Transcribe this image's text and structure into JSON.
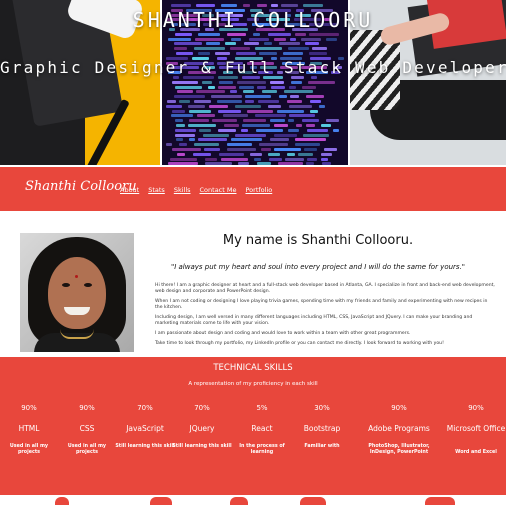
{
  "hero": {
    "title": "SHANTHI COLLOORU",
    "subtitle": "Graphic Designer & Full Stack Web Developer"
  },
  "nav": {
    "brand": "Shanthi Collooru",
    "links": [
      "About",
      "Stats",
      "Skills",
      "Contact Me",
      "Portfolio"
    ]
  },
  "about": {
    "heading": "My name is Shanthi Collooru.",
    "quote": "\"I always put my heart and soul into every project and I will do the same for yours.\"",
    "paragraphs": [
      "Hi there! I am a graphic designer at heart and a full-stack web developer based in Atlanta, GA. I specialize in front and back-end web development, web design and corporate and PowerPoint design.",
      "When I am not coding or designing I love playing trivia games, spending time with my friends and family and experimenting with new recipes in the kitchen.",
      "Including design, I am well versed in many different languages including HTML, CSS, JavaScript and JQuery. I can make your branding and marketing materials come to life with your vision.",
      "I am passionate about design and coding and would love to work within a team with other great programmers.",
      "Take time to look through my portfolio, my LinkedIn profile or you can contact me directly. I look forward to working with you!"
    ]
  },
  "skills": {
    "title": "TECHNICAL SKILLS",
    "subtitle": "A representation of my proficiency in each skill",
    "items": [
      {
        "percent": "90%",
        "name": "HTML",
        "note": "Used in all my projects"
      },
      {
        "percent": "90%",
        "name": "CSS",
        "note": "Used in all my projects"
      },
      {
        "percent": "70%",
        "name": "JavaScript",
        "note": "Still learning this skill"
      },
      {
        "percent": "70%",
        "name": "JQuery",
        "note": "Still learning this skill"
      },
      {
        "percent": "5%",
        "name": "React",
        "note": "In the process of learning"
      },
      {
        "percent": "30%",
        "name": "Bootstrap",
        "note": "Familiar with"
      },
      {
        "percent": "90%",
        "name": "Adobe Programs",
        "note": "PhotoShop, Illustrator, InDesign, PowerPoint"
      },
      {
        "percent": "90%",
        "name": "Microsoft Office",
        "note": "Word and Excel"
      }
    ]
  },
  "colors": {
    "accent": "#e8473c",
    "text": "#111111",
    "white": "#ffffff"
  }
}
